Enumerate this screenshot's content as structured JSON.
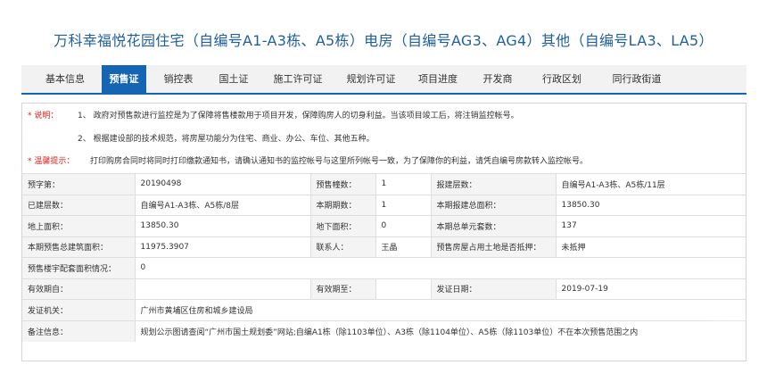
{
  "page": {
    "title": "万科幸福悦花园住宅（自编号A1-A3栋、A5栋）电房（自编号AG3、AG4）其他（自编号LA3、LA5）"
  },
  "tabs": [
    {
      "label": "基本信息"
    },
    {
      "label": "预售证"
    },
    {
      "label": "销控表"
    },
    {
      "label": "国土证"
    },
    {
      "label": "施工许可证"
    },
    {
      "label": "规划许可证"
    },
    {
      "label": "项目进度"
    },
    {
      "label": "开发商"
    },
    {
      "label": "行政区划"
    },
    {
      "label": "同行政街道"
    }
  ],
  "notes": {
    "note_label": "* 说明：",
    "line1": "1、 政府对预售款进行监控是为了保障将售楼款用于项目开发，保障购房人的切身利益。当该项目竣工后，将注销监控帐号。",
    "line2": "2、 根据建设部的技术规范，将房屋功能分为住宅、商业、办公、车位、其他五种。",
    "tip_label": "* 温馨提示：",
    "tip": "打印购房合同时将同时打印缴款通知书，请确认通知书的监控帐号与这里所列帐号一致，为了保障你的利益，请凭自编号房款转入监控帐号。"
  },
  "rows": [
    {
      "c": [
        "预字第：",
        "20190498",
        "预售幢数：",
        "1",
        "报建层数：",
        "自编号A1-A3栋、A5栋/11层"
      ]
    },
    {
      "c": [
        "已建层数：",
        "自编号A1-A3栋、A5栋/8层",
        "本期期数：",
        "1",
        "本期报建总面积：",
        "13850.30"
      ]
    },
    {
      "c": [
        "地上面积：",
        "13850.30",
        "地下面积：",
        "0",
        "本期总单元套数：",
        "137"
      ]
    },
    {
      "c": [
        "本期预售总建筑面积：",
        "11975.3907",
        "联系人：",
        "王晶",
        "预售房屋占用土地是否抵押：",
        "未抵押"
      ]
    },
    {
      "c": [
        "预售楼宇配套面积情况：",
        "0"
      ]
    },
    {
      "c": [
        "有效期自：",
        "",
        "有效期至：",
        "",
        "发证日期：",
        "2019-07-19"
      ]
    },
    {
      "c": [
        "发证机关：",
        "广州市黄埔区住房和城乡建设局"
      ]
    },
    {
      "c": [
        "备注信息：",
        "规划公示图请查阅“广州市国土规划委”网站;自编A1栋（除1103单位）、A3栋（除1104单位）、A5栋（除1103单位）不在本次预售范围之内"
      ]
    }
  ]
}
